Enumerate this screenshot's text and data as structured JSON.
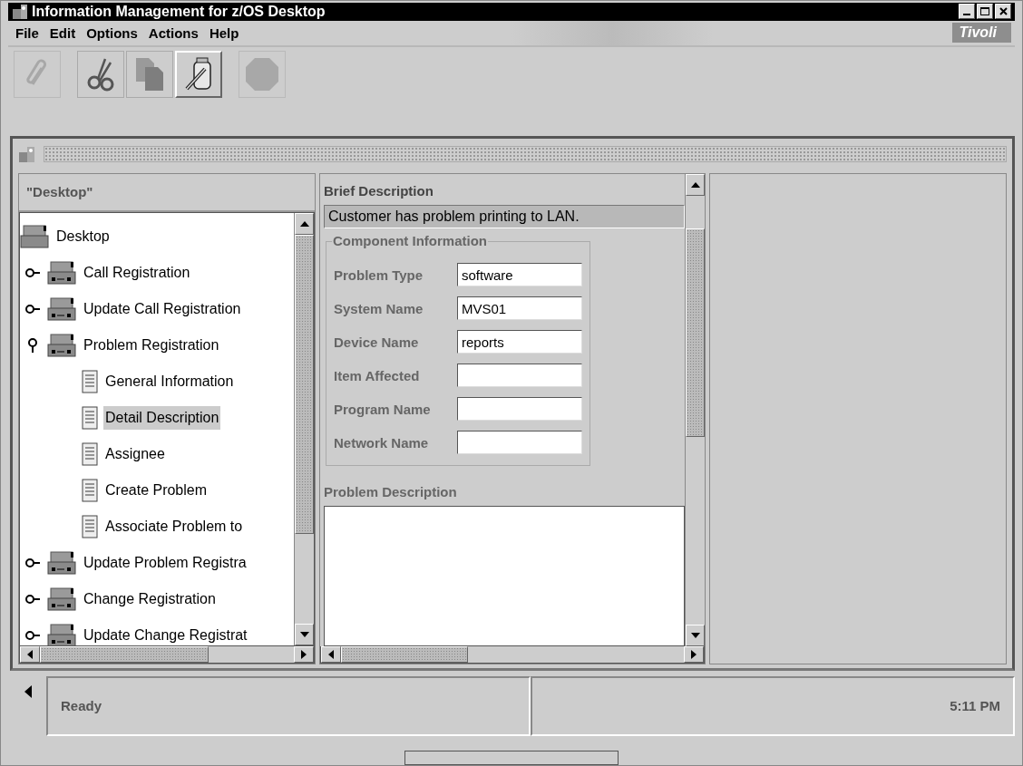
{
  "window": {
    "title": "Information Management for z/OS Desktop"
  },
  "menu": [
    "File",
    "Edit",
    "Options",
    "Actions",
    "Help"
  ],
  "brand": "Tivoli",
  "toolbar": [
    {
      "kind": "attach",
      "disabled": true,
      "pressed": false
    },
    {
      "kind": "cut",
      "disabled": false,
      "pressed": false
    },
    {
      "kind": "copy",
      "disabled": false,
      "pressed": false
    },
    {
      "kind": "tool",
      "disabled": false,
      "pressed": true
    },
    {
      "kind": "stop",
      "disabled": true,
      "pressed": false
    }
  ],
  "tree_header": "\"Desktop\"",
  "tree": [
    {
      "label": "Desktop",
      "kind": "root",
      "selected": false,
      "children": [
        {
          "label": "Call Registration",
          "kind": "folder",
          "expanded": false,
          "selected": false
        },
        {
          "label": "Update Call Registration",
          "kind": "folder",
          "expanded": false,
          "selected": false
        },
        {
          "label": "Problem Registration",
          "kind": "folder",
          "expanded": true,
          "selected": false,
          "children": [
            {
              "label": "General Information",
              "kind": "page",
              "selected": false
            },
            {
              "label": "Detail Description",
              "kind": "page",
              "selected": true
            },
            {
              "label": "Assignee",
              "kind": "page",
              "selected": false
            },
            {
              "label": "Create Problem",
              "kind": "page",
              "selected": false
            },
            {
              "label": "Associate Problem to",
              "kind": "page",
              "selected": false
            }
          ]
        },
        {
          "label": "Update Problem Registra",
          "kind": "folder",
          "expanded": false,
          "selected": false
        },
        {
          "label": "Change Registration",
          "kind": "folder",
          "expanded": false,
          "selected": false
        },
        {
          "label": "Update Change Registrat",
          "kind": "folder",
          "expanded": false,
          "selected": false
        }
      ]
    }
  ],
  "form": {
    "brief_label": "Brief Description",
    "brief_value": "Customer has problem printing to LAN.",
    "group_title": "Component Information",
    "fields": [
      {
        "label": "Problem Type",
        "value": "software"
      },
      {
        "label": "System Name",
        "value": "MVS01"
      },
      {
        "label": "Device Name",
        "value": "reports"
      },
      {
        "label": "Item Affected"
      },
      {
        "label": "Program Name"
      },
      {
        "label": "Network Name"
      }
    ],
    "description_label": "Problem Description"
  },
  "status_bar": {
    "message": "Ready",
    "time": "5:11 PM"
  }
}
